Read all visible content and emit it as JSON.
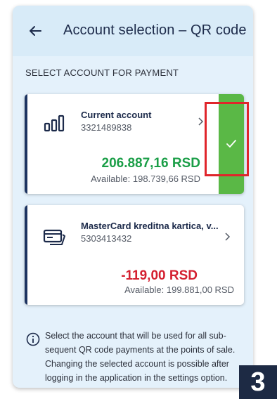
{
  "header": {
    "title": "Account selection – QR code",
    "back_icon": "arrow-left-icon"
  },
  "section_label": "SELECT ACCOUNT FOR PAYMENT",
  "accounts": [
    {
      "name": "Current account",
      "number": "3321489838",
      "balance": "206.887,16 RSD",
      "available": "Available: 198.739,66 RSD",
      "icon": "bar-chart-icon",
      "selected": true,
      "balance_color": "#1a9e47"
    },
    {
      "name": "MasterCard kreditna kartica, v...",
      "number": "5303413432",
      "balance": "-119,00 RSD",
      "available": "Available: 199.881,00 RSD",
      "icon": "credit-card-icon",
      "selected": false,
      "balance_color": "#d42030"
    }
  ],
  "info": {
    "icon": "info-icon",
    "text": "Select the account that will be used for all sub-sequent QR code payments at the points of sale. Changing the selected account is possible after logging in the application in the settings option."
  },
  "step_badge": "3",
  "colors": {
    "accent_navy": "#1d3461",
    "selected_green": "#5ab846",
    "highlight_red": "#e0252b",
    "background": "#e4f1fb"
  }
}
